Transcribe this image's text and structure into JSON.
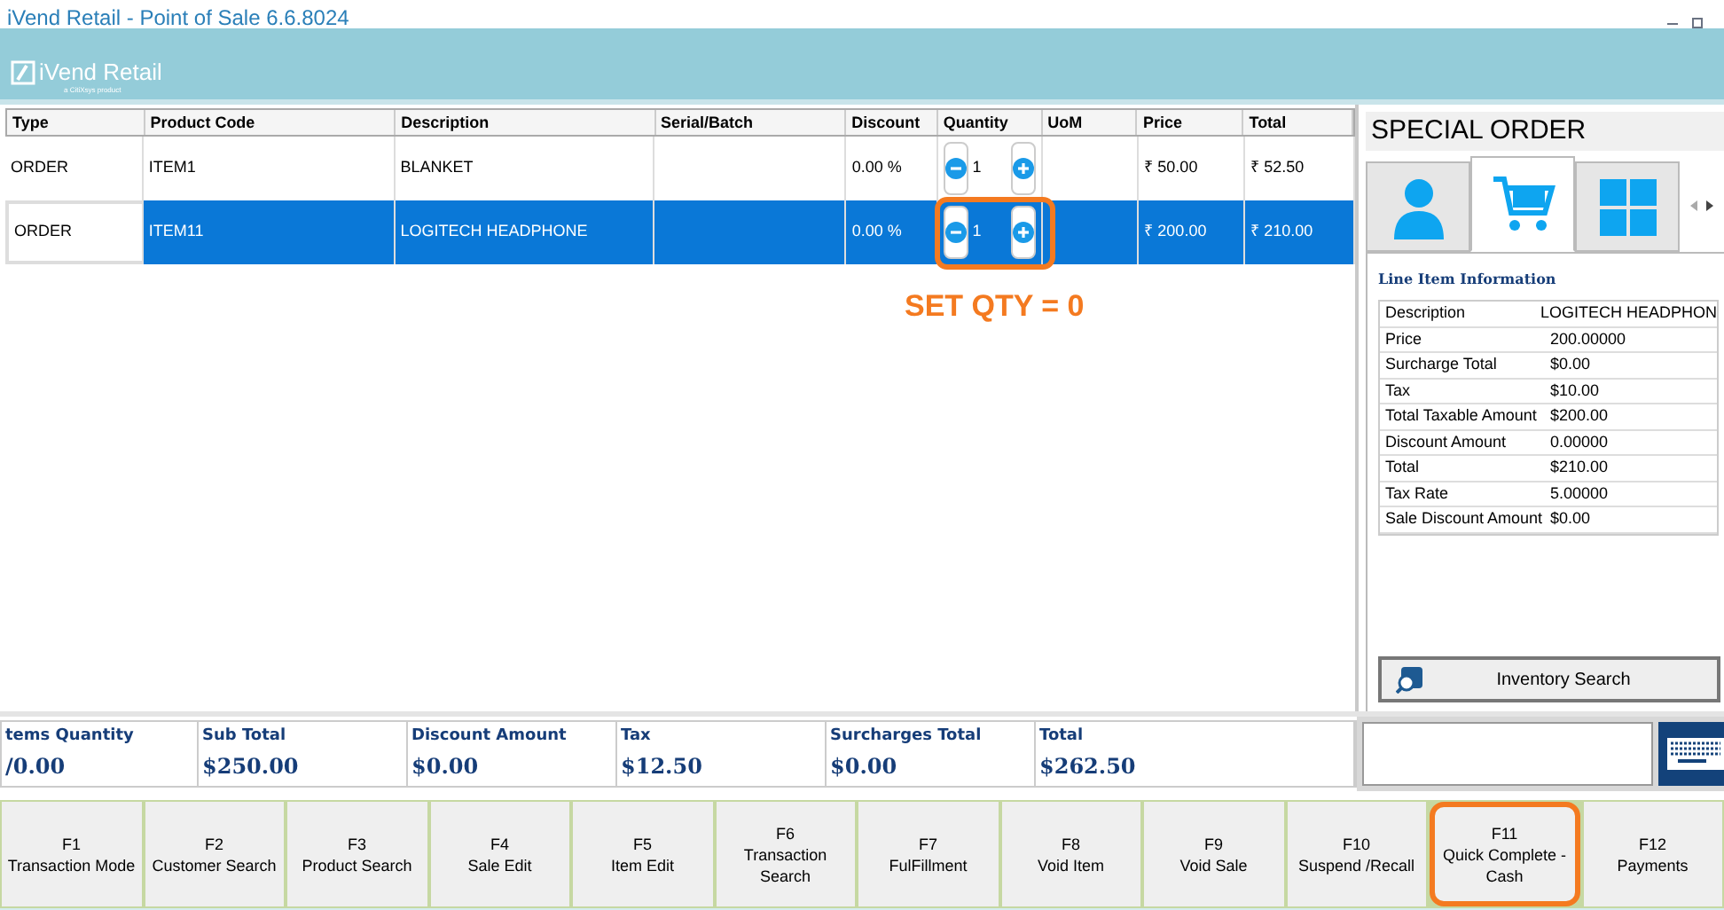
{
  "window": {
    "title": "iVend Retail - Point of Sale 6.6.8024"
  },
  "logo": {
    "name": "iVend Retail",
    "tagline": "a CitiXsys product"
  },
  "table": {
    "columns": [
      "Type",
      "Product Code",
      "Description",
      "Serial/Batch",
      "Discount",
      "Quantity",
      "UoM",
      "Price",
      "Total"
    ],
    "rows": [
      {
        "type": "ORDER",
        "product_code": "ITEM1",
        "description": "BLANKET",
        "serial_batch": "",
        "discount": "0.00 %",
        "quantity": "1",
        "uom": "",
        "price": "₹ 50.00",
        "total": "₹ 52.50",
        "selected": false
      },
      {
        "type": "ORDER",
        "product_code": "ITEM11",
        "description": "LOGITECH HEADPHONE",
        "serial_batch": "",
        "discount": "0.00 %",
        "quantity": "1",
        "uom": "",
        "price": "₹ 200.00",
        "total": "₹ 210.00",
        "selected": true
      }
    ]
  },
  "annotation": {
    "text": "SET QTY = 0"
  },
  "side_panel": {
    "title": "SPECIAL ORDER",
    "tabs": [
      {
        "kind": "user",
        "selected": false
      },
      {
        "kind": "cart",
        "selected": true
      },
      {
        "kind": "grid",
        "selected": false
      }
    ],
    "section_title": "Line Item Information",
    "details": [
      {
        "label": "Description",
        "value": "LOGITECH HEADPHON"
      },
      {
        "label": "Price",
        "value": "200.00000"
      },
      {
        "label": "Surcharge Total",
        "value": "$0.00"
      },
      {
        "label": "Tax",
        "value": "$10.00"
      },
      {
        "label": "Total Taxable Amount",
        "value": "$200.00"
      },
      {
        "label": "Discount Amount",
        "value": "0.00000"
      },
      {
        "label": "Total",
        "value": "$210.00"
      },
      {
        "label": "Tax Rate",
        "value": "5.00000"
      },
      {
        "label": "Sale Discount Amount",
        "value": "$0.00"
      }
    ],
    "inventory_button": "Inventory Search"
  },
  "summary": [
    {
      "label": "tems Quantity",
      "value": "/0.00"
    },
    {
      "label": "Sub Total",
      "value": "$250.00"
    },
    {
      "label": "Discount Amount",
      "value": "$0.00"
    },
    {
      "label": "Tax",
      "value": "$12.50"
    },
    {
      "label": "Surcharges Total",
      "value": "$0.00"
    },
    {
      "label": "Total",
      "value": "$262.50"
    }
  ],
  "function_keys": [
    {
      "key": "F1",
      "label": "Transaction Mode",
      "highlighted": false
    },
    {
      "key": "F2",
      "label": "Customer Search",
      "highlighted": false
    },
    {
      "key": "F3",
      "label": "Product Search",
      "highlighted": false
    },
    {
      "key": "F4",
      "label": "Sale Edit",
      "highlighted": false
    },
    {
      "key": "F5",
      "label": "Item Edit",
      "highlighted": false
    },
    {
      "key": "F6",
      "label": "Transaction Search",
      "highlighted": false
    },
    {
      "key": "F7",
      "label": "FulFillment",
      "highlighted": false
    },
    {
      "key": "F8",
      "label": "Void Item",
      "highlighted": false
    },
    {
      "key": "F9",
      "label": "Void Sale",
      "highlighted": false
    },
    {
      "key": "F10",
      "label": "Suspend /Recall",
      "highlighted": false
    },
    {
      "key": "F11",
      "label": "Quick Complete - Cash",
      "highlighted": true
    },
    {
      "key": "F12",
      "label": "Payments",
      "highlighted": false
    }
  ]
}
